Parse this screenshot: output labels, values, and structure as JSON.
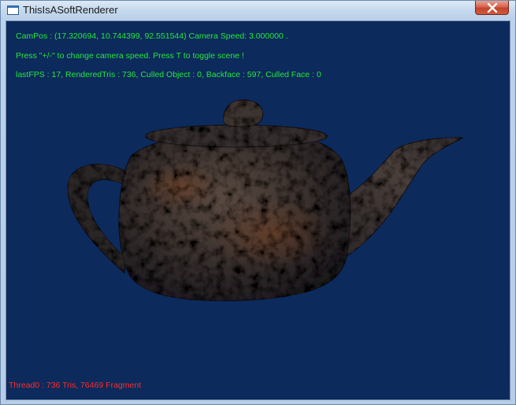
{
  "window": {
    "title": "ThisIsASoftRenderer"
  },
  "hud": {
    "camera": "CamPos : (17.320694, 10.744399, 92.551544) Camera Speed: 3.000000 .",
    "help": "Press \"+/-\" to change camera speed. Press T to toggle scene !",
    "stats": "lastFPS : 17, RenderedTris : 736, Culled Object : 0, Backface : 597, Culled Face : 0",
    "thread": "Thread0 : 736 Tris,  76469 Fragment"
  },
  "colors": {
    "viewport_background": "#0c2a5c",
    "hud_text": "#25e83a",
    "thread_text": "#ff2a2a"
  },
  "icons": [
    "app-window-icon",
    "close-icon"
  ]
}
